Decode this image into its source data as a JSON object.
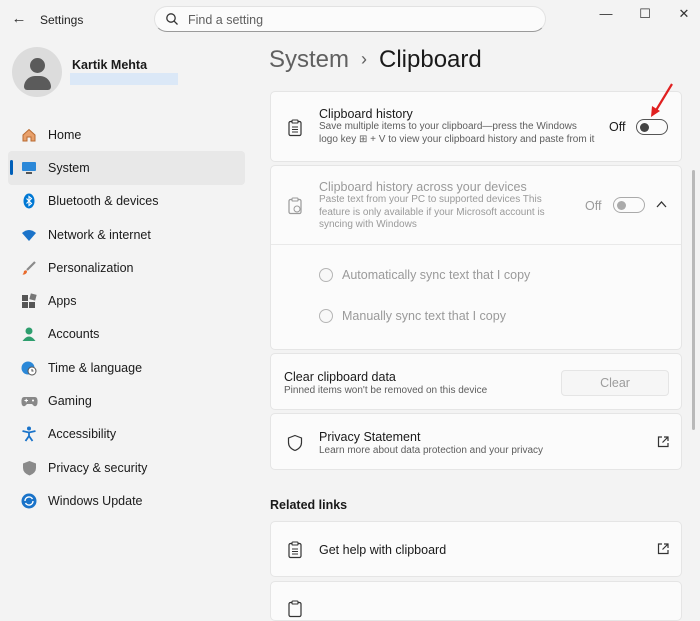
{
  "titlebar": {
    "app_title": "Settings",
    "back_icon": "back-arrow-icon",
    "search_placeholder": "Find a setting",
    "window_controls": [
      "minimize",
      "maximize",
      "close"
    ]
  },
  "user": {
    "name": "Kartik Mehta"
  },
  "nav": [
    {
      "label": "Home",
      "icon": "home-icon",
      "selected": false
    },
    {
      "label": "System",
      "icon": "system-icon",
      "selected": true
    },
    {
      "label": "Bluetooth & devices",
      "icon": "bluetooth-icon",
      "selected": false
    },
    {
      "label": "Network & internet",
      "icon": "wifi-icon",
      "selected": false
    },
    {
      "label": "Personalization",
      "icon": "paintbrush-icon",
      "selected": false
    },
    {
      "label": "Apps",
      "icon": "apps-icon",
      "selected": false
    },
    {
      "label": "Accounts",
      "icon": "accounts-icon",
      "selected": false
    },
    {
      "label": "Time & language",
      "icon": "globe-clock-icon",
      "selected": false
    },
    {
      "label": "Gaming",
      "icon": "gamepad-icon",
      "selected": false
    },
    {
      "label": "Accessibility",
      "icon": "accessibility-icon",
      "selected": false
    },
    {
      "label": "Privacy & security",
      "icon": "shield-icon",
      "selected": false
    },
    {
      "label": "Windows Update",
      "icon": "update-icon",
      "selected": false
    }
  ],
  "breadcrumb": {
    "parent": "System",
    "separator": "›",
    "current": "Clipboard"
  },
  "clipboard_history": {
    "title": "Clipboard history",
    "desc": "Save multiple items to your clipboard—press the Windows logo key ⊞ + V to view your clipboard history and paste from it",
    "state_label": "Off",
    "enabled": false
  },
  "cross_device": {
    "title": "Clipboard history across your devices",
    "desc": "Paste text from your PC to supported devices This feature is only available if your Microsoft account is syncing with Windows",
    "state_label": "Off",
    "enabled": false,
    "disabled": true,
    "options": [
      "Automatically sync text that I copy",
      "Manually sync text that I copy"
    ]
  },
  "clear_data": {
    "title": "Clear clipboard data",
    "desc": "Pinned items won't be removed on this device",
    "button": "Clear"
  },
  "privacy": {
    "title": "Privacy Statement",
    "desc": "Learn more about data protection and your privacy"
  },
  "related_links": {
    "heading": "Related links",
    "items": [
      {
        "label": "Get help with clipboard"
      }
    ]
  },
  "colors": {
    "accent": "#005fb8",
    "annotation_arrow": "#e02020"
  }
}
